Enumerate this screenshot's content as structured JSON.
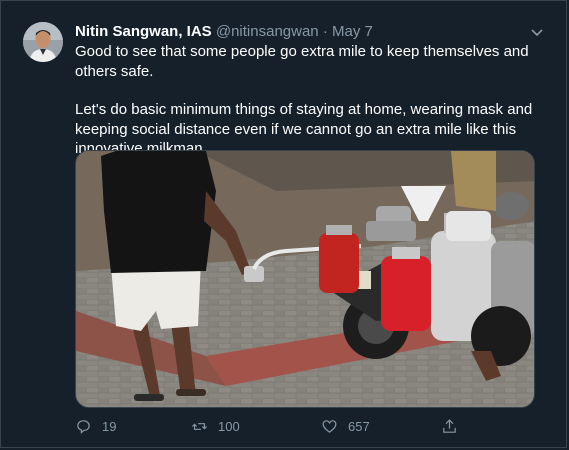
{
  "tweet": {
    "author_name": "Nitin Sangwan, IAS",
    "author_handle": "@nitinsangwan",
    "separator": "·",
    "date": "May 7",
    "paragraphs": [
      "Good to see that some people go extra mile to keep themselves and others safe.",
      "Let's do basic minimum things of staying at home, wearing mask and keeping social distance even if we cannot go an extra mile like this innovative milkman."
    ],
    "media_description": "photo"
  },
  "actions": {
    "replies": "19",
    "retweets": "100",
    "likes": "657"
  },
  "icons": {
    "menu": "chevron-down-icon",
    "reply": "reply-icon",
    "retweet": "retweet-icon",
    "like": "heart-icon",
    "share": "share-icon"
  },
  "colors": {
    "background": "#15202b",
    "secondary_text": "#8899a6",
    "border": "#38444d"
  }
}
